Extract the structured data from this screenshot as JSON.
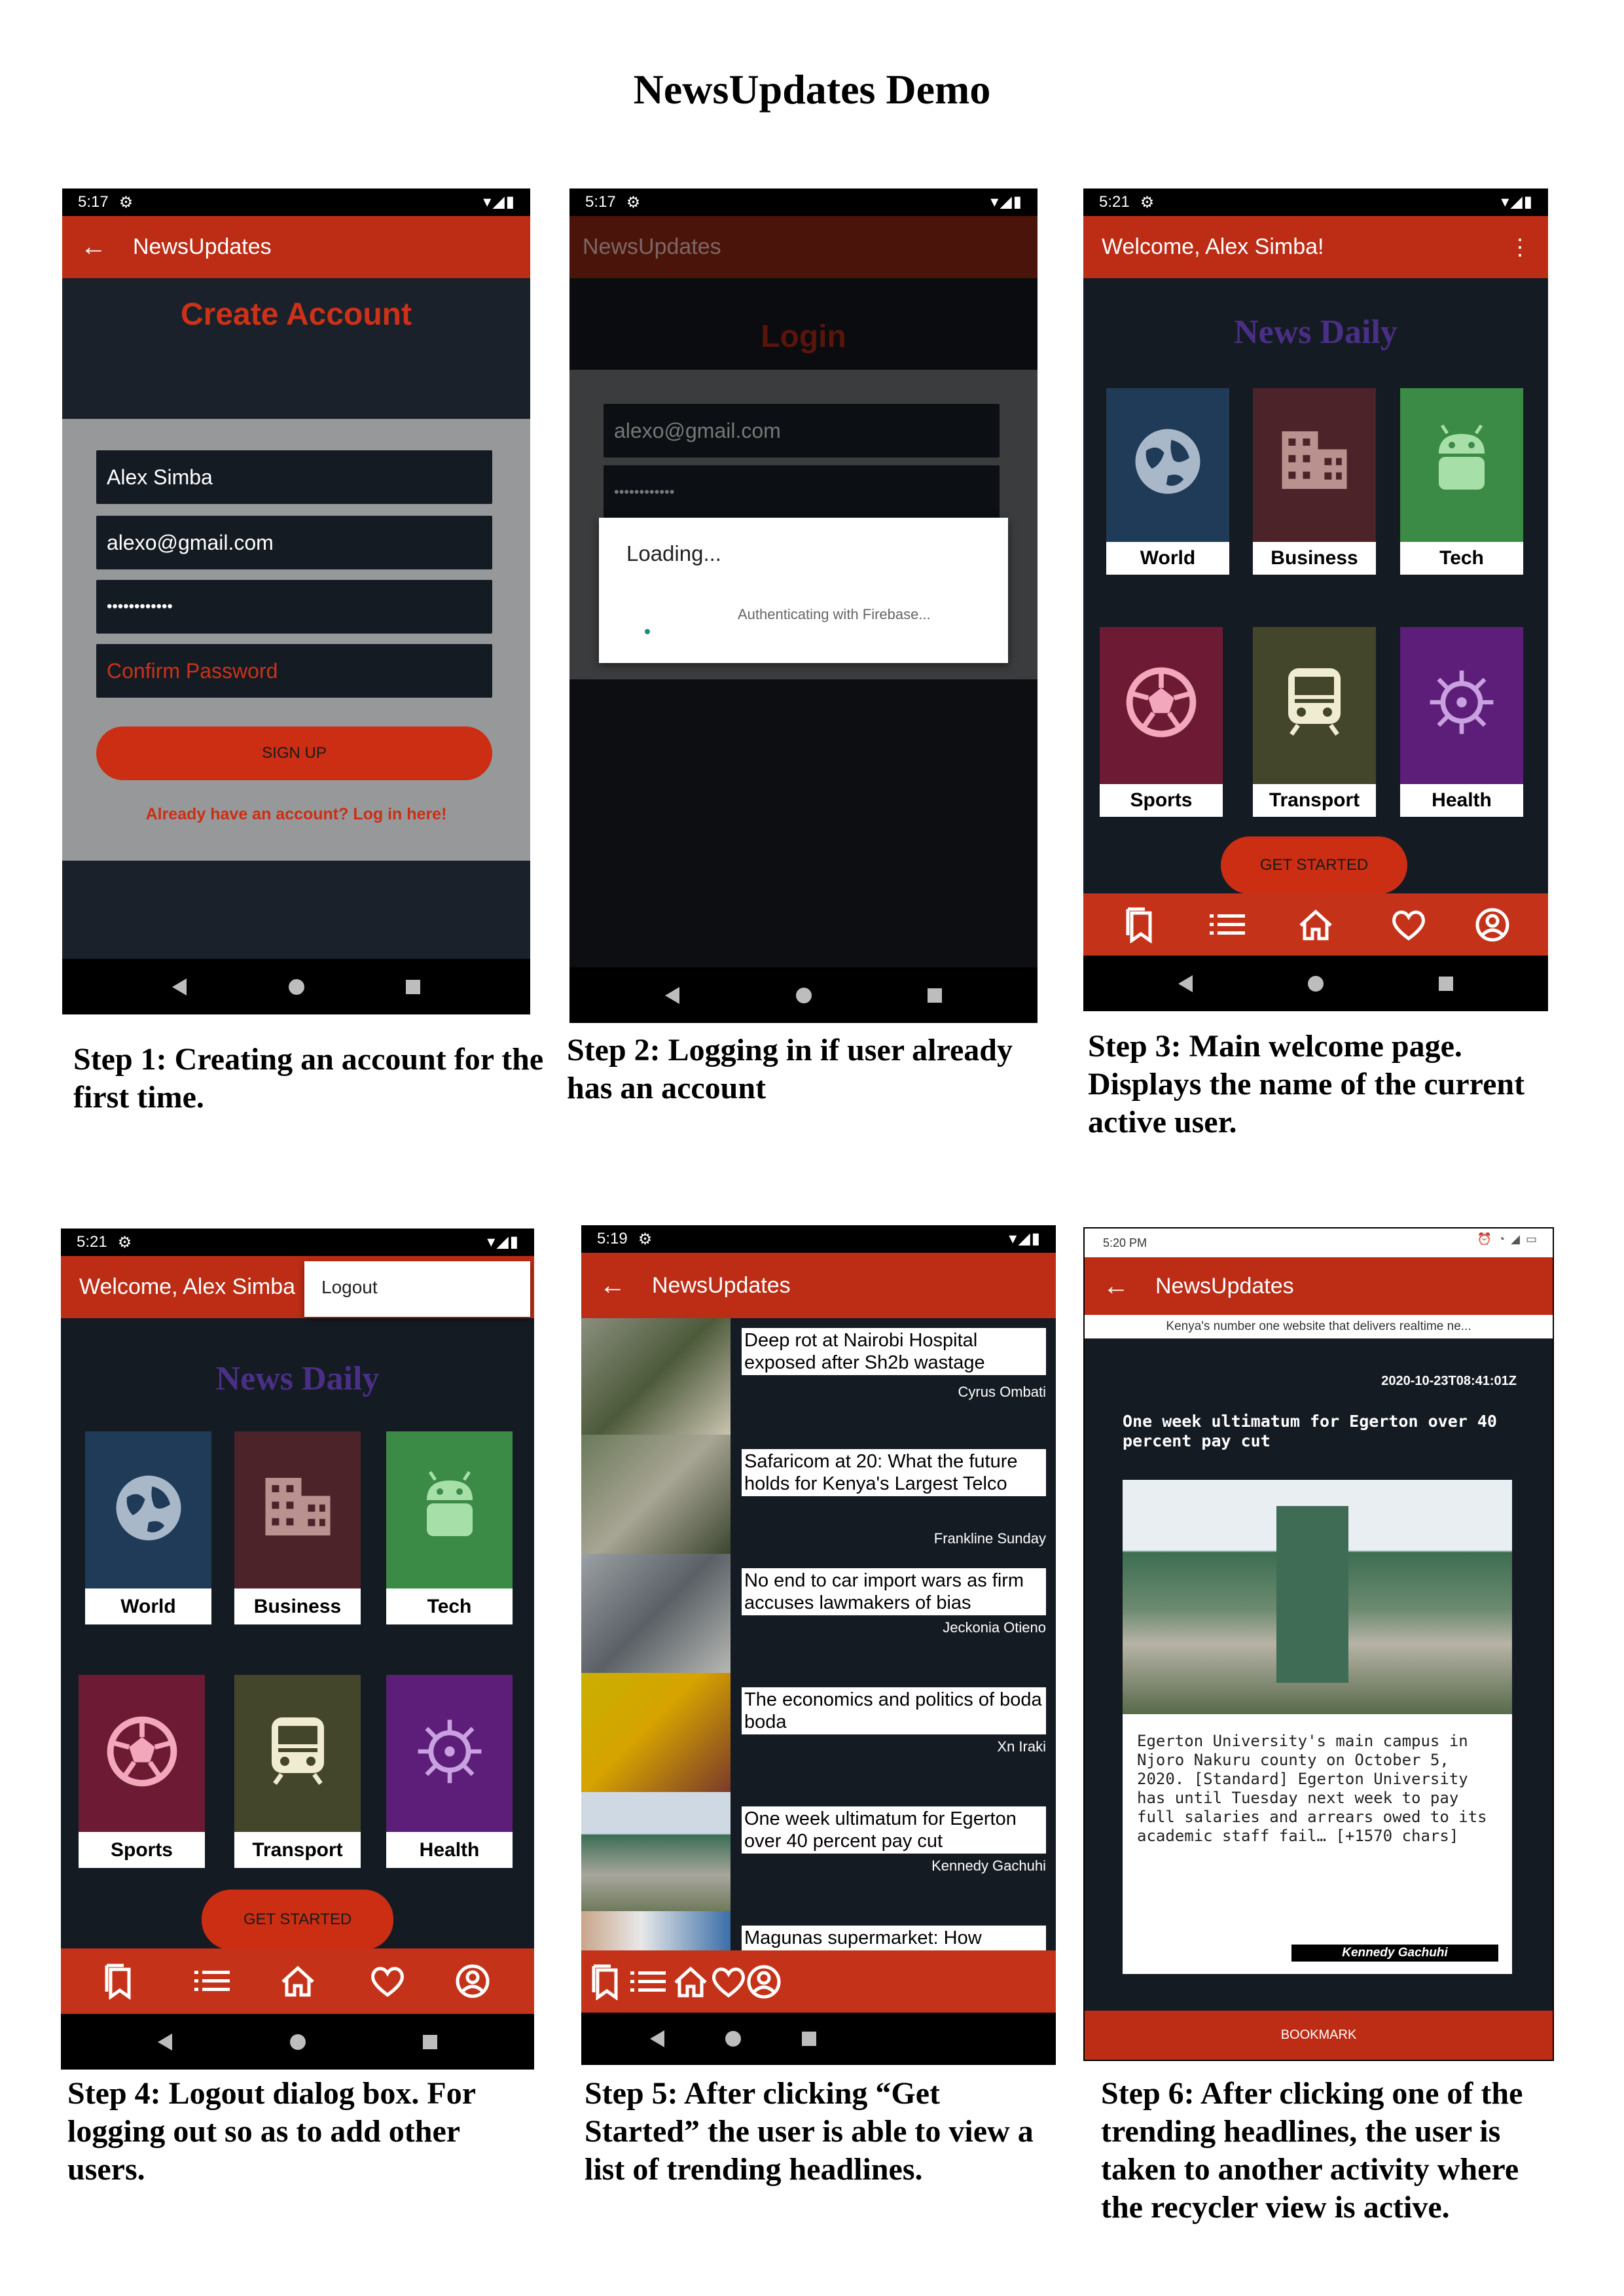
{
  "document": {
    "title": "NewsUpdates Demo"
  },
  "captions": {
    "step1": "Step 1: Creating an account for the first time.",
    "step2": "Step 2: Logging in if user already has an account",
    "step3": "Step 3: Main welcome page. Displays the name of the current active user.",
    "step4": "Step 4: Logout dialog box. For logging out so as to add other users.",
    "step5": "Step 5: After clicking “Get Started” the user is able to view a list of trending headlines.",
    "step6": "Step 6: After clicking one of the trending headlines, the user is taken to another activity where the recycler view is active."
  },
  "screen1": {
    "time": "5:17",
    "app_title": "NewsUpdates",
    "heading": "Create Account",
    "name_value": "Alex Simba",
    "email_value": "alexo@gmail.com",
    "password_value": "••••••••••••",
    "confirm_placeholder": "Confirm Password",
    "signup_label": "SIGN UP",
    "login_link": "Already have an account? Log in here!"
  },
  "screen2": {
    "time": "5:17",
    "app_title": "NewsUpdates",
    "heading": "Login",
    "email_value": "alexo@gmail.com",
    "password_value": "••••••••••••",
    "dialog_title": "Loading...",
    "dialog_message": "Authenticating with Firebase..."
  },
  "screen3": {
    "time": "5:21",
    "welcome": "Welcome, Alex Simba!",
    "heading": "News Daily",
    "categories": [
      "World",
      "Business",
      "Tech",
      "Sports",
      "Transport",
      "Health"
    ],
    "cta": "GET STARTED"
  },
  "screen4": {
    "time": "5:21",
    "welcome": "Welcome, Alex Simba",
    "menu_item": "Logout",
    "heading": "News Daily",
    "categories": [
      "World",
      "Business",
      "Tech",
      "Sports",
      "Transport",
      "Health"
    ],
    "cta": "GET STARTED"
  },
  "screen5": {
    "time": "5:19",
    "app_title": "NewsUpdates",
    "articles": [
      {
        "headline": "Deep rot at Nairobi Hospital exposed after Sh2b wastage",
        "author": "Cyrus Ombati"
      },
      {
        "headline": "Safaricom at 20: What the future holds for Kenya's Largest Telco",
        "author": "Frankline Sunday"
      },
      {
        "headline": "No end to car import wars as firm accuses lawmakers of bias",
        "author": "Jeckonia Otieno"
      },
      {
        "headline": "The economics and politics of boda boda",
        "author": "Xn Iraki"
      },
      {
        "headline": "One week ultimatum for Egerton over 40 percent pay cut",
        "author": "Kennedy Gachuhi"
      },
      {
        "headline": "Magunas supermarket: How",
        "author": ""
      }
    ]
  },
  "screen6": {
    "time": "5:20 PM",
    "app_title": "NewsUpdates",
    "tagline": "Kenya's number one website that delivers realtime ne...",
    "published": "2020-10-23T08:41:01Z",
    "headline": "One week ultimatum for Egerton over 40 percent pay cut",
    "body": "Egerton University's main campus in Njoro Nakuru county on October 5, 2020. [Standard] Egerton University has until Tuesday next week to pay full salaries and arrears owed to its academic staff fail… [+1570 chars]",
    "author": "Kennedy Gachuhi",
    "bookmark_label": "BOOKMARK"
  },
  "colors": {
    "app_red": "#bd2c14",
    "dark_bg": "#151b23",
    "world": "#1f3b57",
    "business": "#4c2328",
    "tech": "#3b8a45",
    "sports": "#6d1a34",
    "transport": "#44462c",
    "health": "#5c1e78",
    "heading_purple": "#4a2f86"
  }
}
